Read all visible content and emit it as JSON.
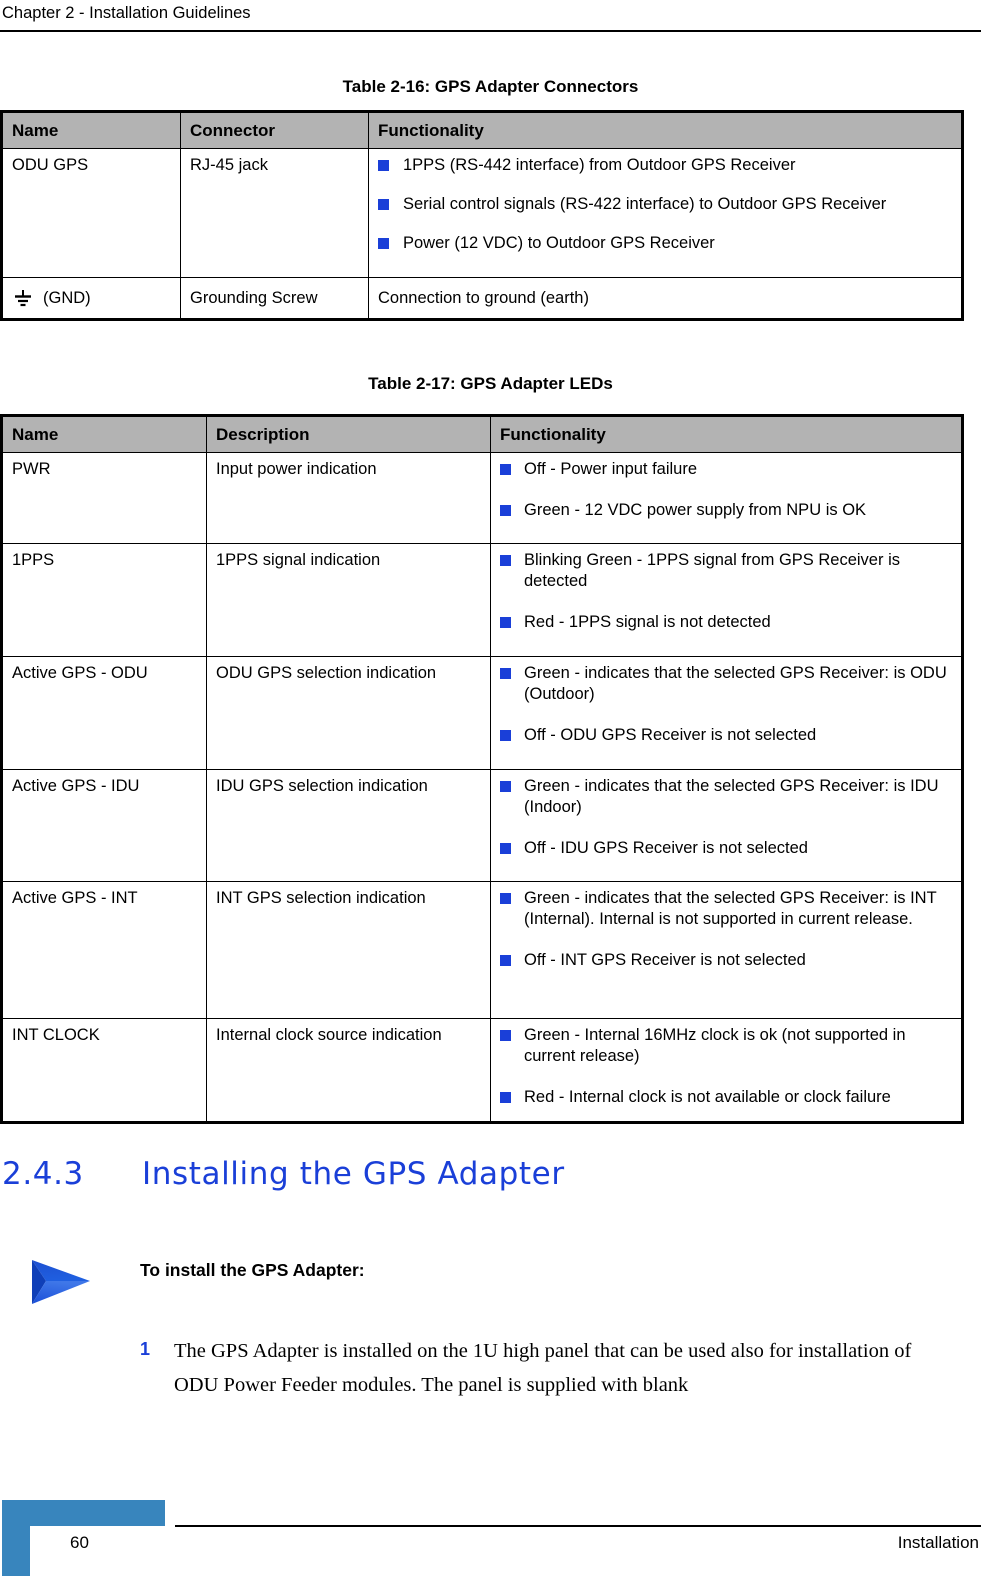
{
  "header": {
    "running_head": "Chapter 2 - Installation Guidelines"
  },
  "table_2_16": {
    "caption": "Table 2-16: GPS Adapter Connectors",
    "columns": [
      "Name",
      "Connector",
      "Functionality"
    ],
    "rows": [
      {
        "name": "ODU GPS",
        "connector": "RJ-45 jack",
        "functionality": [
          "1PPS (RS-442 interface) from Outdoor GPS Receiver",
          "Serial control signals (RS-422 interface) to Outdoor GPS Receiver",
          "Power (12 VDC) to Outdoor GPS Receiver"
        ]
      },
      {
        "name": "(GND)",
        "name_icon": "earth-ground-icon",
        "connector": "Grounding Screw",
        "functionality_text": "Connection to ground (earth)"
      }
    ]
  },
  "table_2_17": {
    "caption": "Table 2-17: GPS Adapter LEDs",
    "columns": [
      "Name",
      "Description",
      "Functionality"
    ],
    "rows": [
      {
        "name": "PWR",
        "description": "Input power indication",
        "functionality": [
          "Off - Power input failure",
          "Green - 12 VDC power supply from NPU is OK"
        ]
      },
      {
        "name": "1PPS",
        "description": "1PPS signal indication",
        "functionality": [
          "Blinking Green - 1PPS signal from GPS Receiver is detected",
          "Red - 1PPS signal is not detected"
        ]
      },
      {
        "name": "Active GPS - ODU",
        "description": "ODU GPS selection indication",
        "functionality": [
          "Green - indicates that the selected GPS Receiver: is ODU (Outdoor)",
          "Off - ODU GPS Receiver is not selected"
        ]
      },
      {
        "name": "Active GPS - IDU",
        "description": "IDU GPS selection indication",
        "functionality": [
          "Green - indicates that the selected GPS Receiver: is IDU (Indoor)",
          "Off - IDU GPS Receiver is not selected"
        ]
      },
      {
        "name": "Active GPS - INT",
        "description": "INT GPS selection indication",
        "functionality": [
          "Green - indicates that the selected GPS Receiver: is INT (Internal). Internal is not supported in current release.",
          "Off - INT GPS Receiver is not selected"
        ]
      },
      {
        "name": "INT CLOCK",
        "description": "Internal clock source indication",
        "functionality": [
          "Green - Internal 16MHz clock is ok (not supported in current release)",
          "Red - Internal clock is not available or clock failure"
        ]
      }
    ]
  },
  "section": {
    "number": "2.4.3",
    "title": "Installing the GPS Adapter"
  },
  "procedure": {
    "arrow_icon": "blue-arrow-icon",
    "title": "To install the GPS Adapter:",
    "steps": [
      {
        "number": "1",
        "text": "The GPS Adapter is installed on the 1U high panel that can be used also for installation of ODU Power Feeder modules. The panel is supplied with blank"
      }
    ]
  },
  "footer": {
    "page_number": "60",
    "label": "Installation"
  },
  "colors": {
    "accent_blue": "#1a3fd8",
    "footer_blue": "#3885bd",
    "table_header_gray": "#b3b3b3"
  }
}
